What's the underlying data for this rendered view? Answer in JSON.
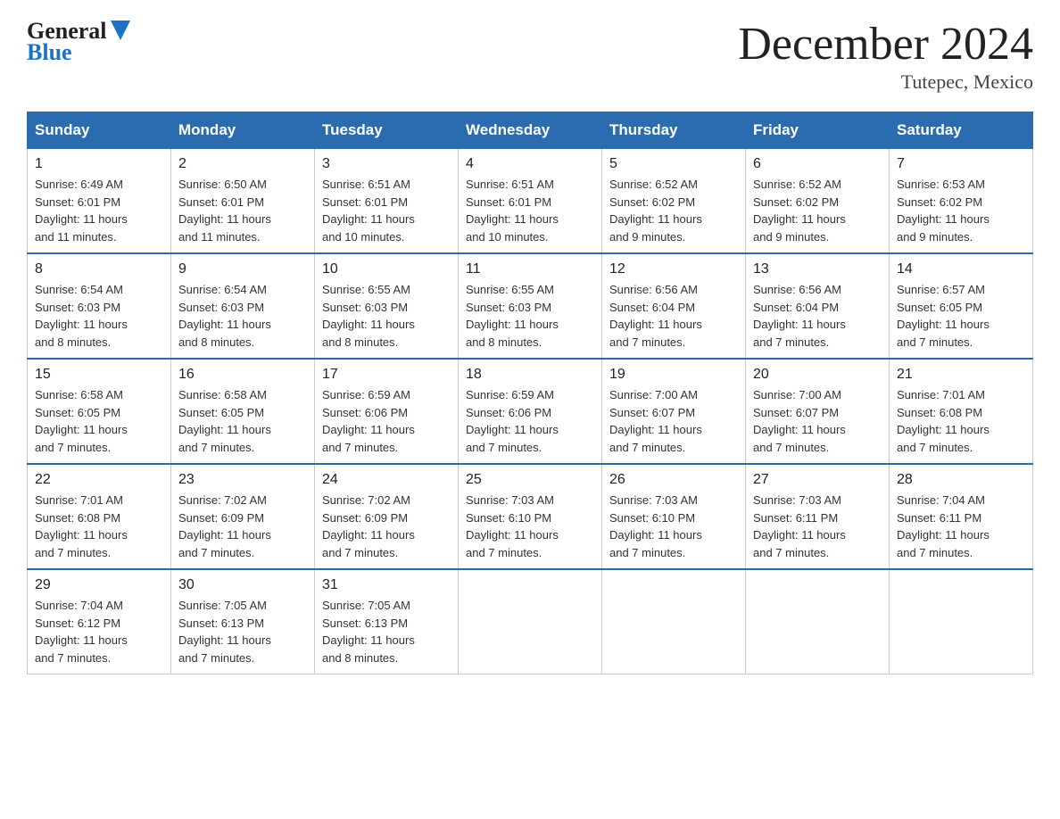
{
  "logo": {
    "general": "General",
    "blue": "Blue"
  },
  "title": "December 2024",
  "subtitle": "Tutepec, Mexico",
  "days_of_week": [
    "Sunday",
    "Monday",
    "Tuesday",
    "Wednesday",
    "Thursday",
    "Friday",
    "Saturday"
  ],
  "weeks": [
    [
      {
        "date": "1",
        "sunrise": "6:49 AM",
        "sunset": "6:01 PM",
        "daylight": "11 hours and 11 minutes."
      },
      {
        "date": "2",
        "sunrise": "6:50 AM",
        "sunset": "6:01 PM",
        "daylight": "11 hours and 11 minutes."
      },
      {
        "date": "3",
        "sunrise": "6:51 AM",
        "sunset": "6:01 PM",
        "daylight": "11 hours and 10 minutes."
      },
      {
        "date": "4",
        "sunrise": "6:51 AM",
        "sunset": "6:01 PM",
        "daylight": "11 hours and 10 minutes."
      },
      {
        "date": "5",
        "sunrise": "6:52 AM",
        "sunset": "6:02 PM",
        "daylight": "11 hours and 9 minutes."
      },
      {
        "date": "6",
        "sunrise": "6:52 AM",
        "sunset": "6:02 PM",
        "daylight": "11 hours and 9 minutes."
      },
      {
        "date": "7",
        "sunrise": "6:53 AM",
        "sunset": "6:02 PM",
        "daylight": "11 hours and 9 minutes."
      }
    ],
    [
      {
        "date": "8",
        "sunrise": "6:54 AM",
        "sunset": "6:03 PM",
        "daylight": "11 hours and 8 minutes."
      },
      {
        "date": "9",
        "sunrise": "6:54 AM",
        "sunset": "6:03 PM",
        "daylight": "11 hours and 8 minutes."
      },
      {
        "date": "10",
        "sunrise": "6:55 AM",
        "sunset": "6:03 PM",
        "daylight": "11 hours and 8 minutes."
      },
      {
        "date": "11",
        "sunrise": "6:55 AM",
        "sunset": "6:03 PM",
        "daylight": "11 hours and 8 minutes."
      },
      {
        "date": "12",
        "sunrise": "6:56 AM",
        "sunset": "6:04 PM",
        "daylight": "11 hours and 7 minutes."
      },
      {
        "date": "13",
        "sunrise": "6:56 AM",
        "sunset": "6:04 PM",
        "daylight": "11 hours and 7 minutes."
      },
      {
        "date": "14",
        "sunrise": "6:57 AM",
        "sunset": "6:05 PM",
        "daylight": "11 hours and 7 minutes."
      }
    ],
    [
      {
        "date": "15",
        "sunrise": "6:58 AM",
        "sunset": "6:05 PM",
        "daylight": "11 hours and 7 minutes."
      },
      {
        "date": "16",
        "sunrise": "6:58 AM",
        "sunset": "6:05 PM",
        "daylight": "11 hours and 7 minutes."
      },
      {
        "date": "17",
        "sunrise": "6:59 AM",
        "sunset": "6:06 PM",
        "daylight": "11 hours and 7 minutes."
      },
      {
        "date": "18",
        "sunrise": "6:59 AM",
        "sunset": "6:06 PM",
        "daylight": "11 hours and 7 minutes."
      },
      {
        "date": "19",
        "sunrise": "7:00 AM",
        "sunset": "6:07 PM",
        "daylight": "11 hours and 7 minutes."
      },
      {
        "date": "20",
        "sunrise": "7:00 AM",
        "sunset": "6:07 PM",
        "daylight": "11 hours and 7 minutes."
      },
      {
        "date": "21",
        "sunrise": "7:01 AM",
        "sunset": "6:08 PM",
        "daylight": "11 hours and 7 minutes."
      }
    ],
    [
      {
        "date": "22",
        "sunrise": "7:01 AM",
        "sunset": "6:08 PM",
        "daylight": "11 hours and 7 minutes."
      },
      {
        "date": "23",
        "sunrise": "7:02 AM",
        "sunset": "6:09 PM",
        "daylight": "11 hours and 7 minutes."
      },
      {
        "date": "24",
        "sunrise": "7:02 AM",
        "sunset": "6:09 PM",
        "daylight": "11 hours and 7 minutes."
      },
      {
        "date": "25",
        "sunrise": "7:03 AM",
        "sunset": "6:10 PM",
        "daylight": "11 hours and 7 minutes."
      },
      {
        "date": "26",
        "sunrise": "7:03 AM",
        "sunset": "6:10 PM",
        "daylight": "11 hours and 7 minutes."
      },
      {
        "date": "27",
        "sunrise": "7:03 AM",
        "sunset": "6:11 PM",
        "daylight": "11 hours and 7 minutes."
      },
      {
        "date": "28",
        "sunrise": "7:04 AM",
        "sunset": "6:11 PM",
        "daylight": "11 hours and 7 minutes."
      }
    ],
    [
      {
        "date": "29",
        "sunrise": "7:04 AM",
        "sunset": "6:12 PM",
        "daylight": "11 hours and 7 minutes."
      },
      {
        "date": "30",
        "sunrise": "7:05 AM",
        "sunset": "6:13 PM",
        "daylight": "11 hours and 7 minutes."
      },
      {
        "date": "31",
        "sunrise": "7:05 AM",
        "sunset": "6:13 PM",
        "daylight": "11 hours and 8 minutes."
      },
      null,
      null,
      null,
      null
    ]
  ],
  "labels": {
    "sunrise": "Sunrise:",
    "sunset": "Sunset:",
    "daylight": "Daylight:"
  }
}
